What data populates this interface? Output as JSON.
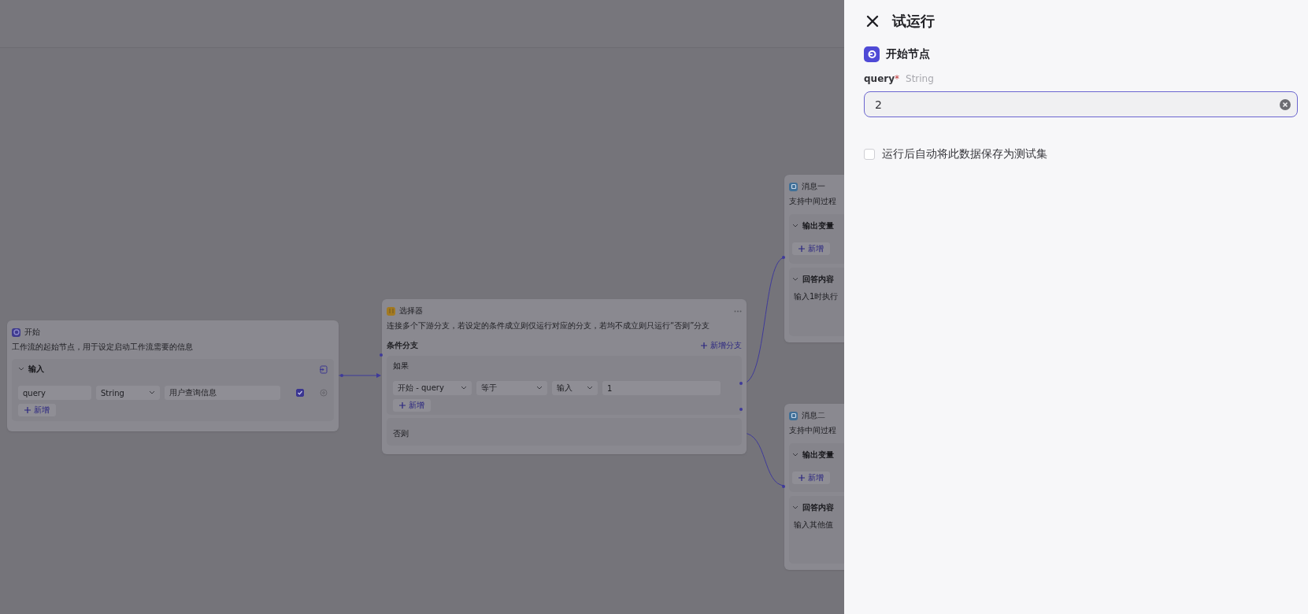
{
  "canvas": {
    "nodes": [
      {
        "kind": "start",
        "title": "开始",
        "description": "工作流的起始节点，用于设定启动工作流需要的信息",
        "section_title": "输入",
        "variable": {
          "name": "query",
          "type": "String",
          "description": "用户查询信息",
          "required": true
        },
        "add_label": "新增"
      },
      {
        "kind": "selector",
        "title": "选择器",
        "description": "连接多个下游分支，若设定的条件成立则仅运行对应的分支，若均不成立则只运行“否则”分支",
        "branch_title": "条件分支",
        "add_branch": "新增分支",
        "if_label": "如果",
        "condition": {
          "variable": "开始 - query",
          "operator": "等于",
          "source": "输入",
          "value": "1"
        },
        "add_label": "新增",
        "else_label": "否则"
      },
      {
        "kind": "message",
        "title": "消息一",
        "description": "支持中间过程",
        "output_title": "输出变量",
        "add_label": "新增",
        "answer_title": "回答内容",
        "answer": "输入1时执行"
      },
      {
        "kind": "message",
        "title": "消息二",
        "description": "支持中间过程",
        "output_title": "输出变量",
        "add_label": "新增",
        "answer_title": "回答内容",
        "answer": "输入其他值"
      }
    ]
  },
  "panel": {
    "title": "试运行",
    "node_title": "开始节点",
    "field": {
      "name": "query",
      "required_mark": "*",
      "type": "String",
      "value": "2"
    },
    "save_option": {
      "label": "运行后自动将此数据保存为测试集",
      "checked": false
    }
  }
}
